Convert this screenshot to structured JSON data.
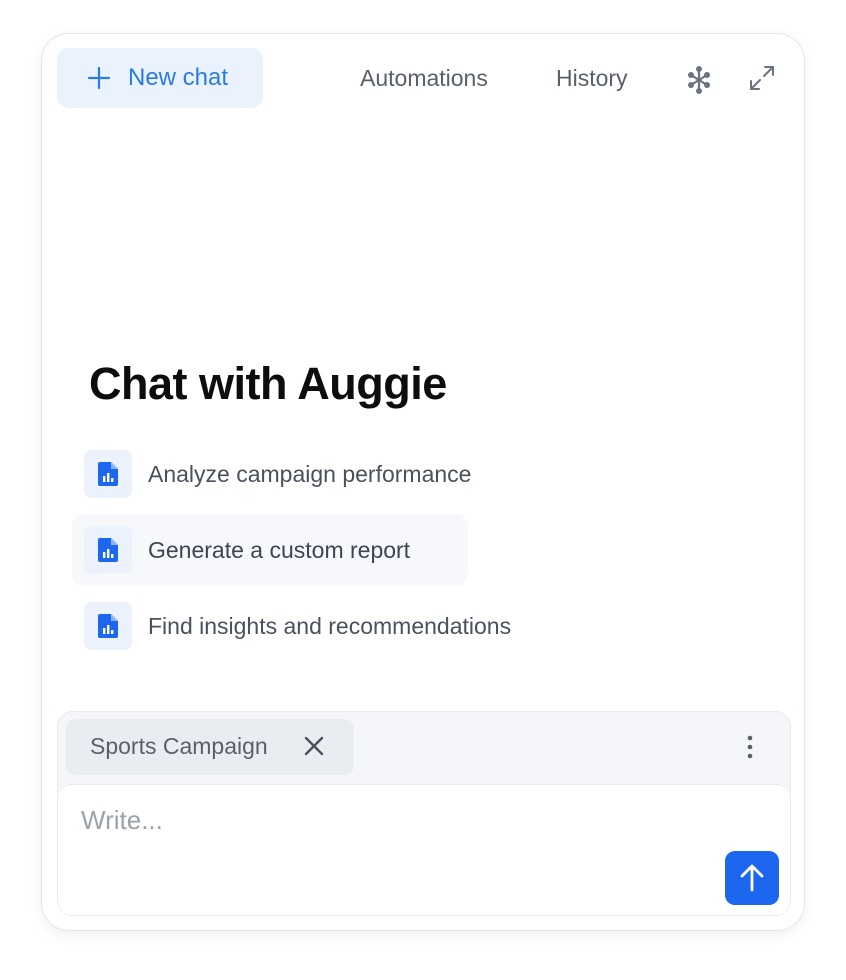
{
  "header": {
    "new_chat_label": "New chat",
    "automations_label": "Automations",
    "history_label": "History",
    "icons": [
      "plus-icon",
      "network-icon",
      "expand-icon"
    ]
  },
  "main": {
    "title": "Chat with Auggie",
    "suggestions": [
      {
        "label": "Analyze campaign performance",
        "icon": "report-file-icon"
      },
      {
        "label": "Generate a custom report",
        "icon": "report-file-icon"
      },
      {
        "label": "Find insights and recommendations",
        "icon": "report-file-icon"
      }
    ]
  },
  "composer": {
    "context_chip": "Sports Campaign",
    "placeholder": "Write...",
    "icons": [
      "close-icon",
      "more-vertical-icon",
      "arrow-up-icon"
    ]
  },
  "colors": {
    "accent": "#2c7be0",
    "send_button": "#1d66f0",
    "icon_blue": "#1d66f0",
    "muted_text": "#59606b"
  }
}
